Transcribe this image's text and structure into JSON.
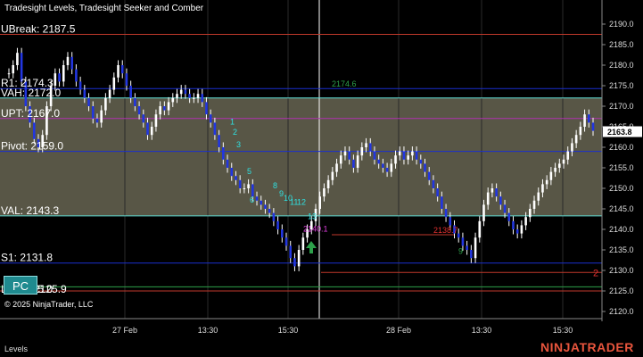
{
  "window": {
    "title": "Tradesight Levels, Tradesight Seeker and Comber"
  },
  "copyright": "© 2025 NinjaTrader, LLC",
  "tab": {
    "label": "Levels"
  },
  "brand": "NINJATRADER",
  "pc_button": {
    "label": "PC"
  },
  "price_axis": {
    "min": 2120,
    "max": 2190,
    "ticks": [
      "2120.0",
      "2125.0",
      "2130.0",
      "2135.0",
      "2140.0",
      "2145.0",
      "2150.0",
      "2155.0",
      "2160.0",
      "2165.0",
      "2170.0",
      "2175.0",
      "2180.0",
      "2185.0",
      "2190.0"
    ],
    "current_price": "2163.8"
  },
  "time_axis": {
    "labels": [
      "27 Feb",
      "13:30",
      "15:30",
      "28 Feb",
      "13:30",
      "15:30"
    ]
  },
  "levels": [
    {
      "label": "UBreak: 2187.5",
      "price": 2187.5,
      "color": "#c0392b"
    },
    {
      "label": "R1: 2174.3",
      "price": 2174.3,
      "color": "#1a2fd0"
    },
    {
      "label": "VAH: 2172.0",
      "price": 2172.0,
      "color": "#5fdcd4"
    },
    {
      "label": "UPT: 2167.0",
      "price": 2167.0,
      "color": "#b030b0"
    },
    {
      "label": "Pivot: 2159.0",
      "price": 2159.0,
      "color": "#1a2fd0"
    },
    {
      "label": "VAL: 2143.3",
      "price": 2143.3,
      "color": "#5fdcd4"
    },
    {
      "label": "S1: 2131.8",
      "price": 2131.8,
      "color": "#1a2fd0"
    }
  ],
  "value_area": {
    "high": 2172.0,
    "low": 2143.3,
    "color": "#a09c80"
  },
  "overlapped_labels": [
    "LB: 2125.0",
    "2125.9"
  ],
  "annotations": {
    "seeker_top": "2174.6",
    "seeker_mid": "2138.7",
    "magenta_price": "2140.1",
    "right_marker": "2",
    "cyan_counts": [
      "1",
      "2",
      "3",
      "5",
      "6",
      "8",
      "9",
      "10",
      "11",
      "12",
      "13"
    ],
    "green_counts": [
      "9"
    ]
  }
}
